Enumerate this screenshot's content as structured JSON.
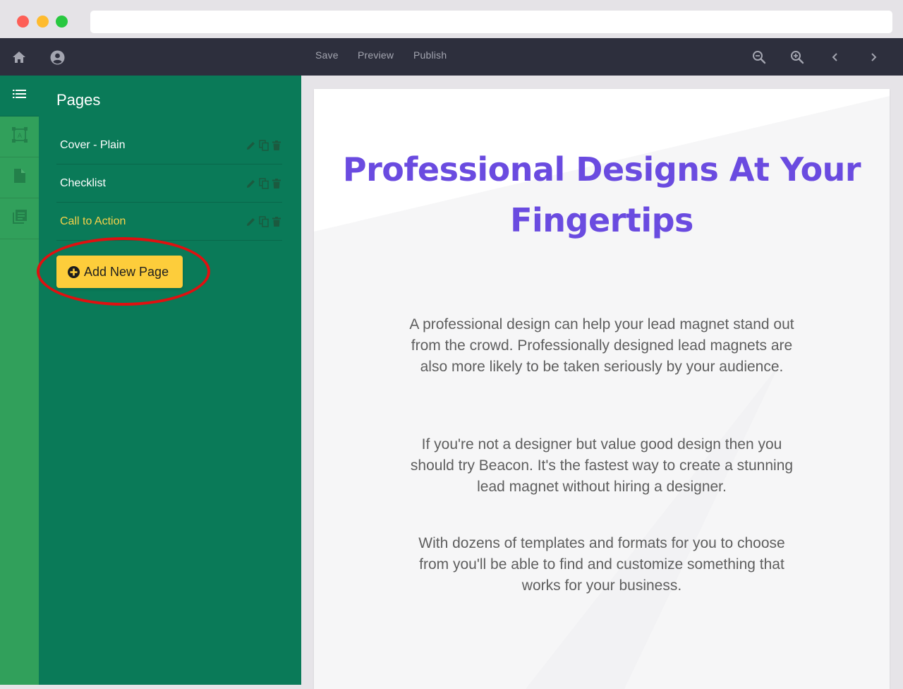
{
  "toolbar": {
    "actions": {
      "save": "Save",
      "preview": "Preview",
      "publish": "Publish"
    },
    "icons": [
      "home-icon",
      "account-icon",
      "zoom-out-icon",
      "zoom-in-icon",
      "chevron-left-icon",
      "chevron-right-icon"
    ]
  },
  "rail": {
    "icons": [
      "list-icon",
      "text-frame-icon",
      "document-icon",
      "library-icon"
    ]
  },
  "panel": {
    "title": "Pages",
    "pages": [
      {
        "name": "Cover - Plain"
      },
      {
        "name": "Checklist"
      },
      {
        "name": "Call to Action"
      }
    ],
    "add_button": "Add New Page"
  },
  "document": {
    "headline": "Professional Designs At Your Fingertips",
    "paragraphs": [
      "A professional design can help your lead magnet stand out from the crowd. Professionally designed lead magnets are also more likely to be taken seriously by your audience.",
      "If you're not a designer but value good design then you should  try Beacon. It's the fastest way to create a stunning lead magnet without hiring a designer.",
      "With dozens of templates and formats for you to choose from you'll be able to find and customize something that works for your business."
    ]
  },
  "colors": {
    "toolbar_bg": "#2d2f3d",
    "rail_bg": "#31a05b",
    "panel_bg": "#0a7a58",
    "button_bg": "#fdcd3b",
    "headline": "#6a4be0",
    "current_page": "#f6d24a",
    "highlight": "#e01010"
  }
}
